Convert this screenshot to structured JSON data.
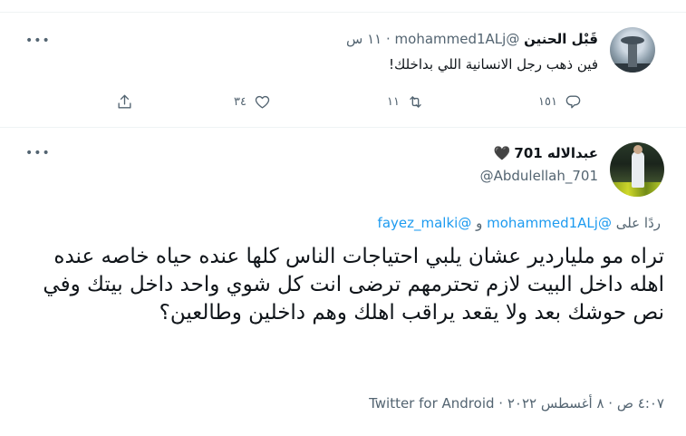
{
  "parent_tweet": {
    "display_name": "قَبْل الحنين",
    "handle": "@mohammed1ALj",
    "separator": "·",
    "time": "١١ س",
    "text": "فين ذهب رجل الانسانية اللي بداخلك!",
    "actions": {
      "reply_count": "١٥١",
      "retweet_count": "١١",
      "like_count": "٣٤"
    },
    "avatar_icon": "profile-photo-tower",
    "more_icon": "more-dots-icon"
  },
  "main_tweet": {
    "display_name": "عبدالاله 701",
    "name_emoji": "🖤",
    "handle": "@Abdulellah_701",
    "reply_prefix": "ردًا على",
    "reply_to_1": "@mohammed1ALj",
    "reply_joiner": "و",
    "reply_to_2": "@fayez_malki",
    "text": "تراه مو ملياردير عشان يلبي احتياجات الناس كلها عنده حياه خاصه عنده اهله داخل البيت لازم تحترمهم ترضى انت كل شوي واحد داخل بيتك وفي نص حوشك بعد ولا يقعد يراقب اهلك وهم داخلين وطالعين؟",
    "time": "٤:٠٧ ص",
    "date": "٨ أغسطس ٢٠٢٢",
    "dot": "·",
    "source": "Twitter for Android",
    "more_icon": "more-dots-icon"
  },
  "colors": {
    "link": "#1d9bf0",
    "muted": "#536471",
    "text": "#0f1419",
    "divider": "#eff3f4"
  }
}
